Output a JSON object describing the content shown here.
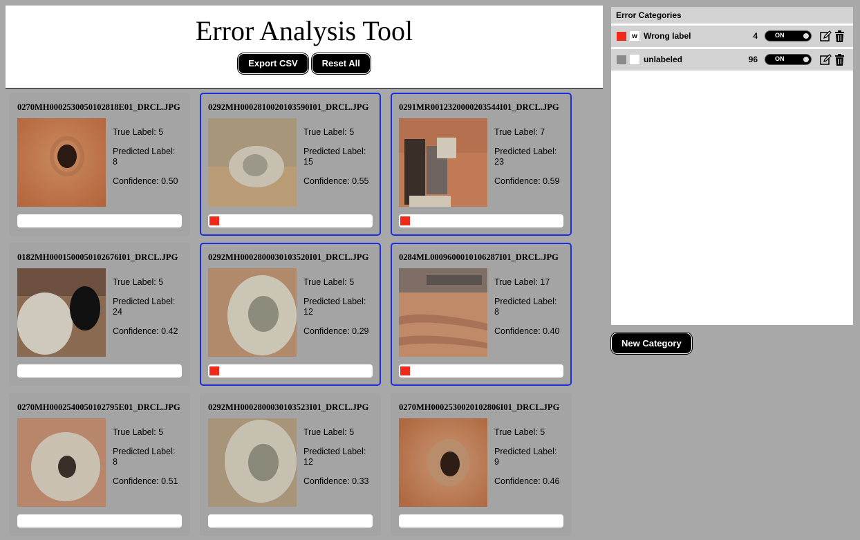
{
  "header": {
    "title": "Error Analysis Tool",
    "export_label": "Export CSV",
    "reset_label": "Reset All"
  },
  "cards": [
    {
      "filename": "0270MH0002530050102818E01_DRCL.JPG",
      "true_label": "True Label: 5",
      "pred_label": "Predicted Label:",
      "pred_value": "8",
      "confidence": "Confidence: 0.50",
      "tagged": false,
      "selected": false
    },
    {
      "filename": "0292MH0002810020103590I01_DRCL.JPG",
      "true_label": "True Label: 5",
      "pred_label": "Predicted Label:",
      "pred_value": "15",
      "confidence": "Confidence: 0.55",
      "tagged": true,
      "selected": true
    },
    {
      "filename": "0291MR0012320000203544I01_DRCL.JPG",
      "true_label": "True Label: 7",
      "pred_label": "Predicted Label:",
      "pred_value": "23",
      "confidence": "Confidence: 0.59",
      "tagged": true,
      "selected": true
    },
    {
      "filename": "0182MH0001500050102676I01_DRCL.JPG",
      "true_label": "True Label: 5",
      "pred_label": "Predicted Label:",
      "pred_value": "24",
      "confidence": "Confidence: 0.42",
      "tagged": false,
      "selected": false
    },
    {
      "filename": "0292MH0002800030103520I01_DRCL.JPG",
      "true_label": "True Label: 5",
      "pred_label": "Predicted Label:",
      "pred_value": "12",
      "confidence": "Confidence: 0.29",
      "tagged": true,
      "selected": true
    },
    {
      "filename": "0284ML0009600010106287I01_DRCL.JPG",
      "true_label": "True Label: 17",
      "pred_label": "Predicted Label:",
      "pred_value": "8",
      "confidence": "Confidence: 0.40",
      "tagged": true,
      "selected": true
    },
    {
      "filename": "0270MH0002540050102795E01_DRCL.JPG",
      "true_label": "True Label: 5",
      "pred_label": "Predicted Label:",
      "pred_value": "8",
      "confidence": "Confidence: 0.51",
      "tagged": false,
      "selected": false
    },
    {
      "filename": "0292MH0002800030103523I01_DRCL.JPG",
      "true_label": "True Label: 5",
      "pred_label": "Predicted Label:",
      "pred_value": "12",
      "confidence": "Confidence: 0.33",
      "tagged": false,
      "selected": false
    },
    {
      "filename": "0270MH0002530020102806I01_DRCL.JPG",
      "true_label": "True Label: 5",
      "pred_label": "Predicted Label:",
      "pred_value": "9",
      "confidence": "Confidence: 0.46",
      "tagged": false,
      "selected": false
    }
  ],
  "sidebar": {
    "title": "Error Categories",
    "categories": [
      {
        "color": "#f02a1a",
        "key": "w",
        "name": "Wrong label",
        "count": "4",
        "toggle": "ON"
      },
      {
        "color": "#8a8a8a",
        "key": "",
        "name": "unlabeled",
        "count": "96",
        "toggle": "ON"
      }
    ],
    "new_category_label": "New Category"
  },
  "colors": {
    "selected_border": "#1a2ee0",
    "tag_red": "#f02a1a"
  }
}
